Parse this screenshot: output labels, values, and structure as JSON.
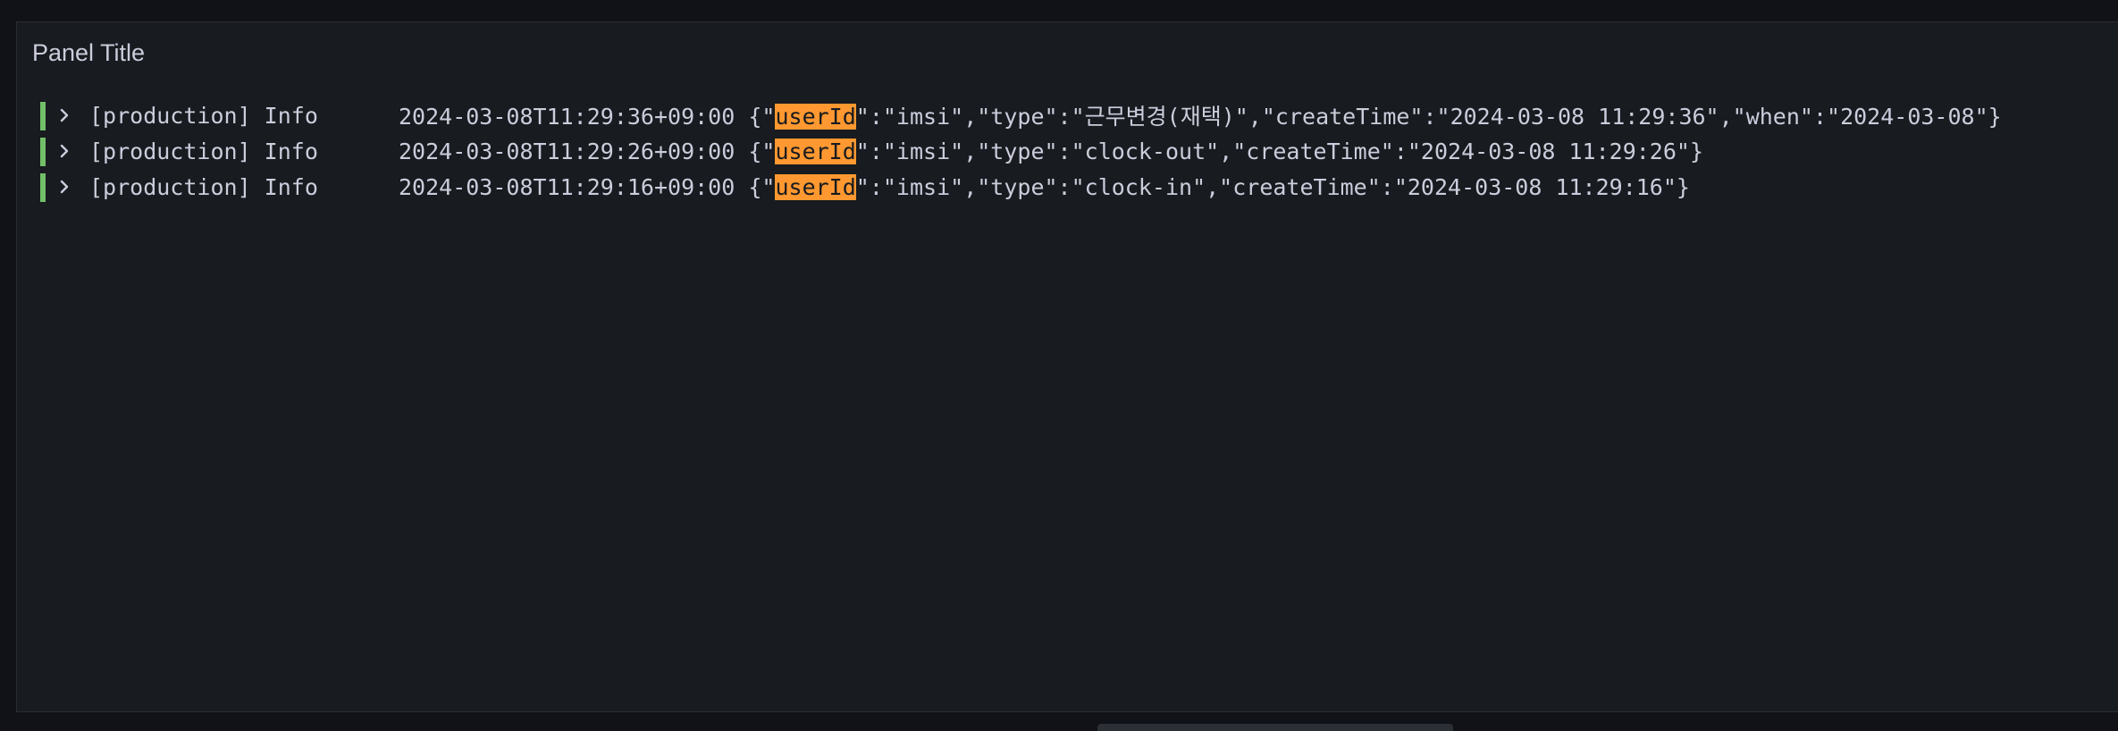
{
  "panel": {
    "title": "Panel Title"
  },
  "logs": [
    {
      "prefix": "[production] Info",
      "timestamp": "2024-03-08T11:29:36+09:00",
      "open": "{\"",
      "highlight": "userId",
      "rest": "\":\"imsi\",\"type\":\"근무변경(재택)\",\"createTime\":\"2024-03-08 11:29:36\",\"when\":\"2024-03-08\"}"
    },
    {
      "prefix": "[production] Info",
      "timestamp": "2024-03-08T11:29:26+09:00",
      "open": "{\"",
      "highlight": "userId",
      "rest": "\":\"imsi\",\"type\":\"clock-out\",\"createTime\":\"2024-03-08 11:29:26\"}"
    },
    {
      "prefix": "[production] Info",
      "timestamp": "2024-03-08T11:29:16+09:00",
      "open": "{\"",
      "highlight": "userId",
      "rest": "\":\"imsi\",\"type\":\"clock-in\",\"createTime\":\"2024-03-08 11:29:16\"}"
    }
  ],
  "colors": {
    "level_info": "#73bf69",
    "highlight": "#ff9830",
    "panel_bg": "#181b1f",
    "page_bg": "#111217",
    "text": "#ccccdc"
  },
  "icons": {
    "expand": "chevron-right-icon"
  }
}
